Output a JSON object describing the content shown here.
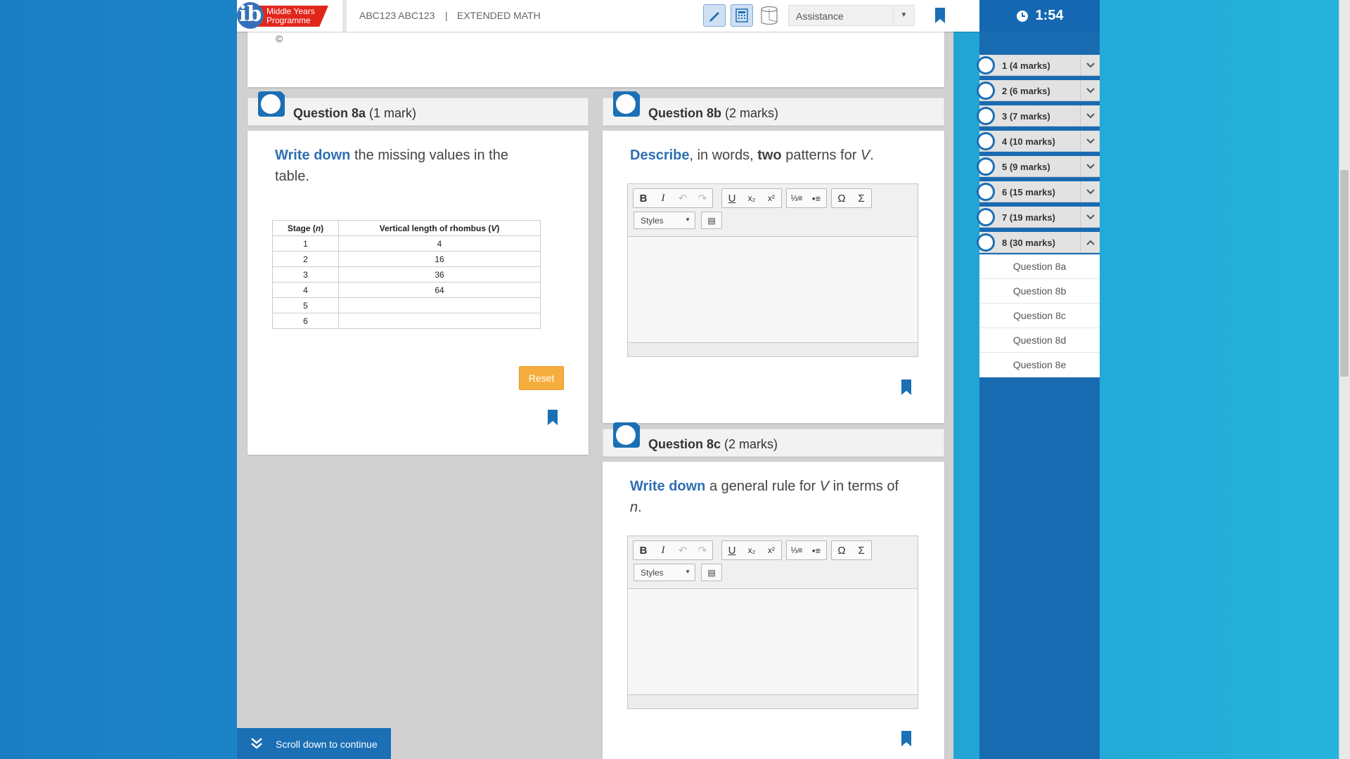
{
  "header": {
    "logo_text": "Middle Years Programme",
    "user": "ABC123 ABC123",
    "separator": "|",
    "course": "EXTENDED MATH",
    "assistance_label": "Assistance",
    "timer": "1:54"
  },
  "prev_card": {
    "symbol": "©"
  },
  "q8a": {
    "title": "Question 8a",
    "marks": "(1 mark)",
    "prompt_keyword": "Write down",
    "prompt_rest": " the missing values in the table.",
    "table": {
      "col1_label": "Stage (",
      "col1_var": "n",
      "col1_close": ")",
      "col2_label": "Vertical length of rhombus (",
      "col2_var": "V",
      "col2_close": ")",
      "rows": [
        [
          "1",
          "4"
        ],
        [
          "2",
          "16"
        ],
        [
          "3",
          "36"
        ],
        [
          "4",
          "64"
        ],
        [
          "5",
          ""
        ],
        [
          "6",
          ""
        ]
      ]
    },
    "reset_label": "Reset"
  },
  "q8b": {
    "title": "Question 8b",
    "marks": "(2 marks)",
    "prompt_keyword": "Describe",
    "prompt_mid": ", in words, ",
    "prompt_bold": "two",
    "prompt_rest": " patterns for ",
    "prompt_var": "V",
    "prompt_end": "."
  },
  "q8c": {
    "title": "Question 8c",
    "marks": "(2 marks)",
    "prompt_keyword": "Write down",
    "prompt_mid": " a general rule for ",
    "prompt_var1": "V",
    "prompt_rest": " in terms of ",
    "prompt_var2": "n",
    "prompt_end": "."
  },
  "editor": {
    "bold": "B",
    "italic": "I",
    "underline": "U",
    "subscript": "x₂",
    "superscript": "x²",
    "omega": "Ω",
    "sigma": "Σ",
    "styles_label": "Styles"
  },
  "nav": {
    "questions": [
      {
        "label": "1 (4 marks)"
      },
      {
        "label": "2 (6 marks)"
      },
      {
        "label": "3 (7 marks)"
      },
      {
        "label": "4 (10 marks)"
      },
      {
        "label": "5 (9 marks)"
      },
      {
        "label": "6 (15 marks)"
      },
      {
        "label": "7 (19 marks)"
      },
      {
        "label": "8 (30 marks)"
      }
    ],
    "subitems": [
      "Question 8a",
      "Question 8b",
      "Question 8c",
      "Question 8d",
      "Question 8e"
    ]
  },
  "scroll_down_label": "Scroll down to continue",
  "colors": {
    "accent": "#1a6fb5",
    "reset": "#f5ad3d",
    "keyword": "#2f6fb3"
  }
}
